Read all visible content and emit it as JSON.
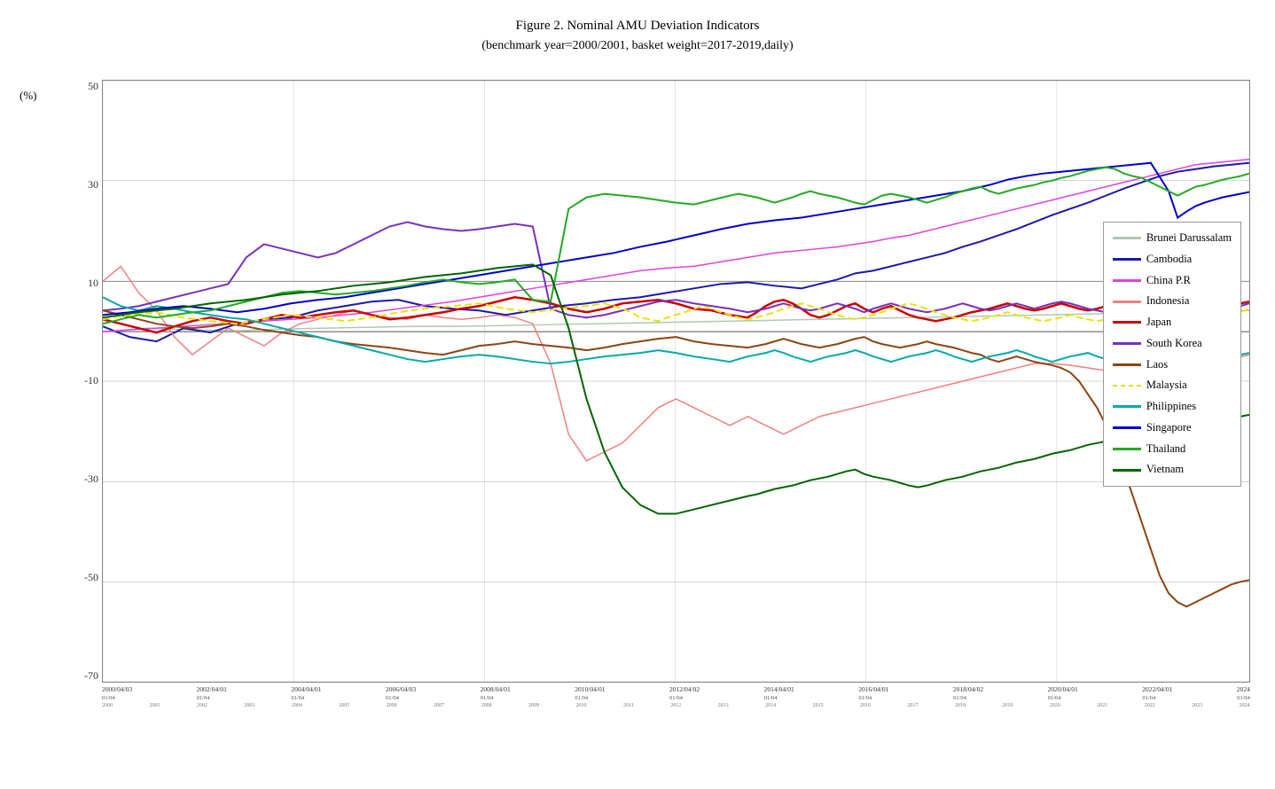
{
  "title": {
    "line1": "Figure 2. Nominal AMU Deviation Indicators",
    "line2": "(benchmark year=2000/2001, basket weight=2017-2019,daily)"
  },
  "yaxis": {
    "label": "(%)",
    "values": [
      "50",
      "30",
      "10",
      "-10",
      "-30",
      "-50",
      "-70"
    ]
  },
  "legend": {
    "items": [
      {
        "label": "Brunei Darussalam",
        "color": "#b0d0b0",
        "style": "solid"
      },
      {
        "label": "Cambodia",
        "color": "#1a1aaa",
        "style": "solid"
      },
      {
        "label": "China P.R",
        "color": "#e040e0",
        "style": "solid"
      },
      {
        "label": "Indonesia",
        "color": "#f08080",
        "style": "solid"
      },
      {
        "label": "Japan",
        "color": "#cc0000",
        "style": "solid"
      },
      {
        "label": "South Korea",
        "color": "#7b2fbe",
        "style": "solid"
      },
      {
        "label": "Laos",
        "color": "#8B4513",
        "style": "solid"
      },
      {
        "label": "Malaysia",
        "color": "#e8e400",
        "style": "dashed"
      },
      {
        "label": "Philippines",
        "color": "#00cccc",
        "style": "solid"
      },
      {
        "label": "Singapore",
        "color": "#0000cc",
        "style": "solid"
      },
      {
        "label": "Thailand",
        "color": "#22aa22",
        "style": "solid"
      },
      {
        "label": "Vietnam",
        "color": "#006600",
        "style": "solid"
      }
    ]
  }
}
